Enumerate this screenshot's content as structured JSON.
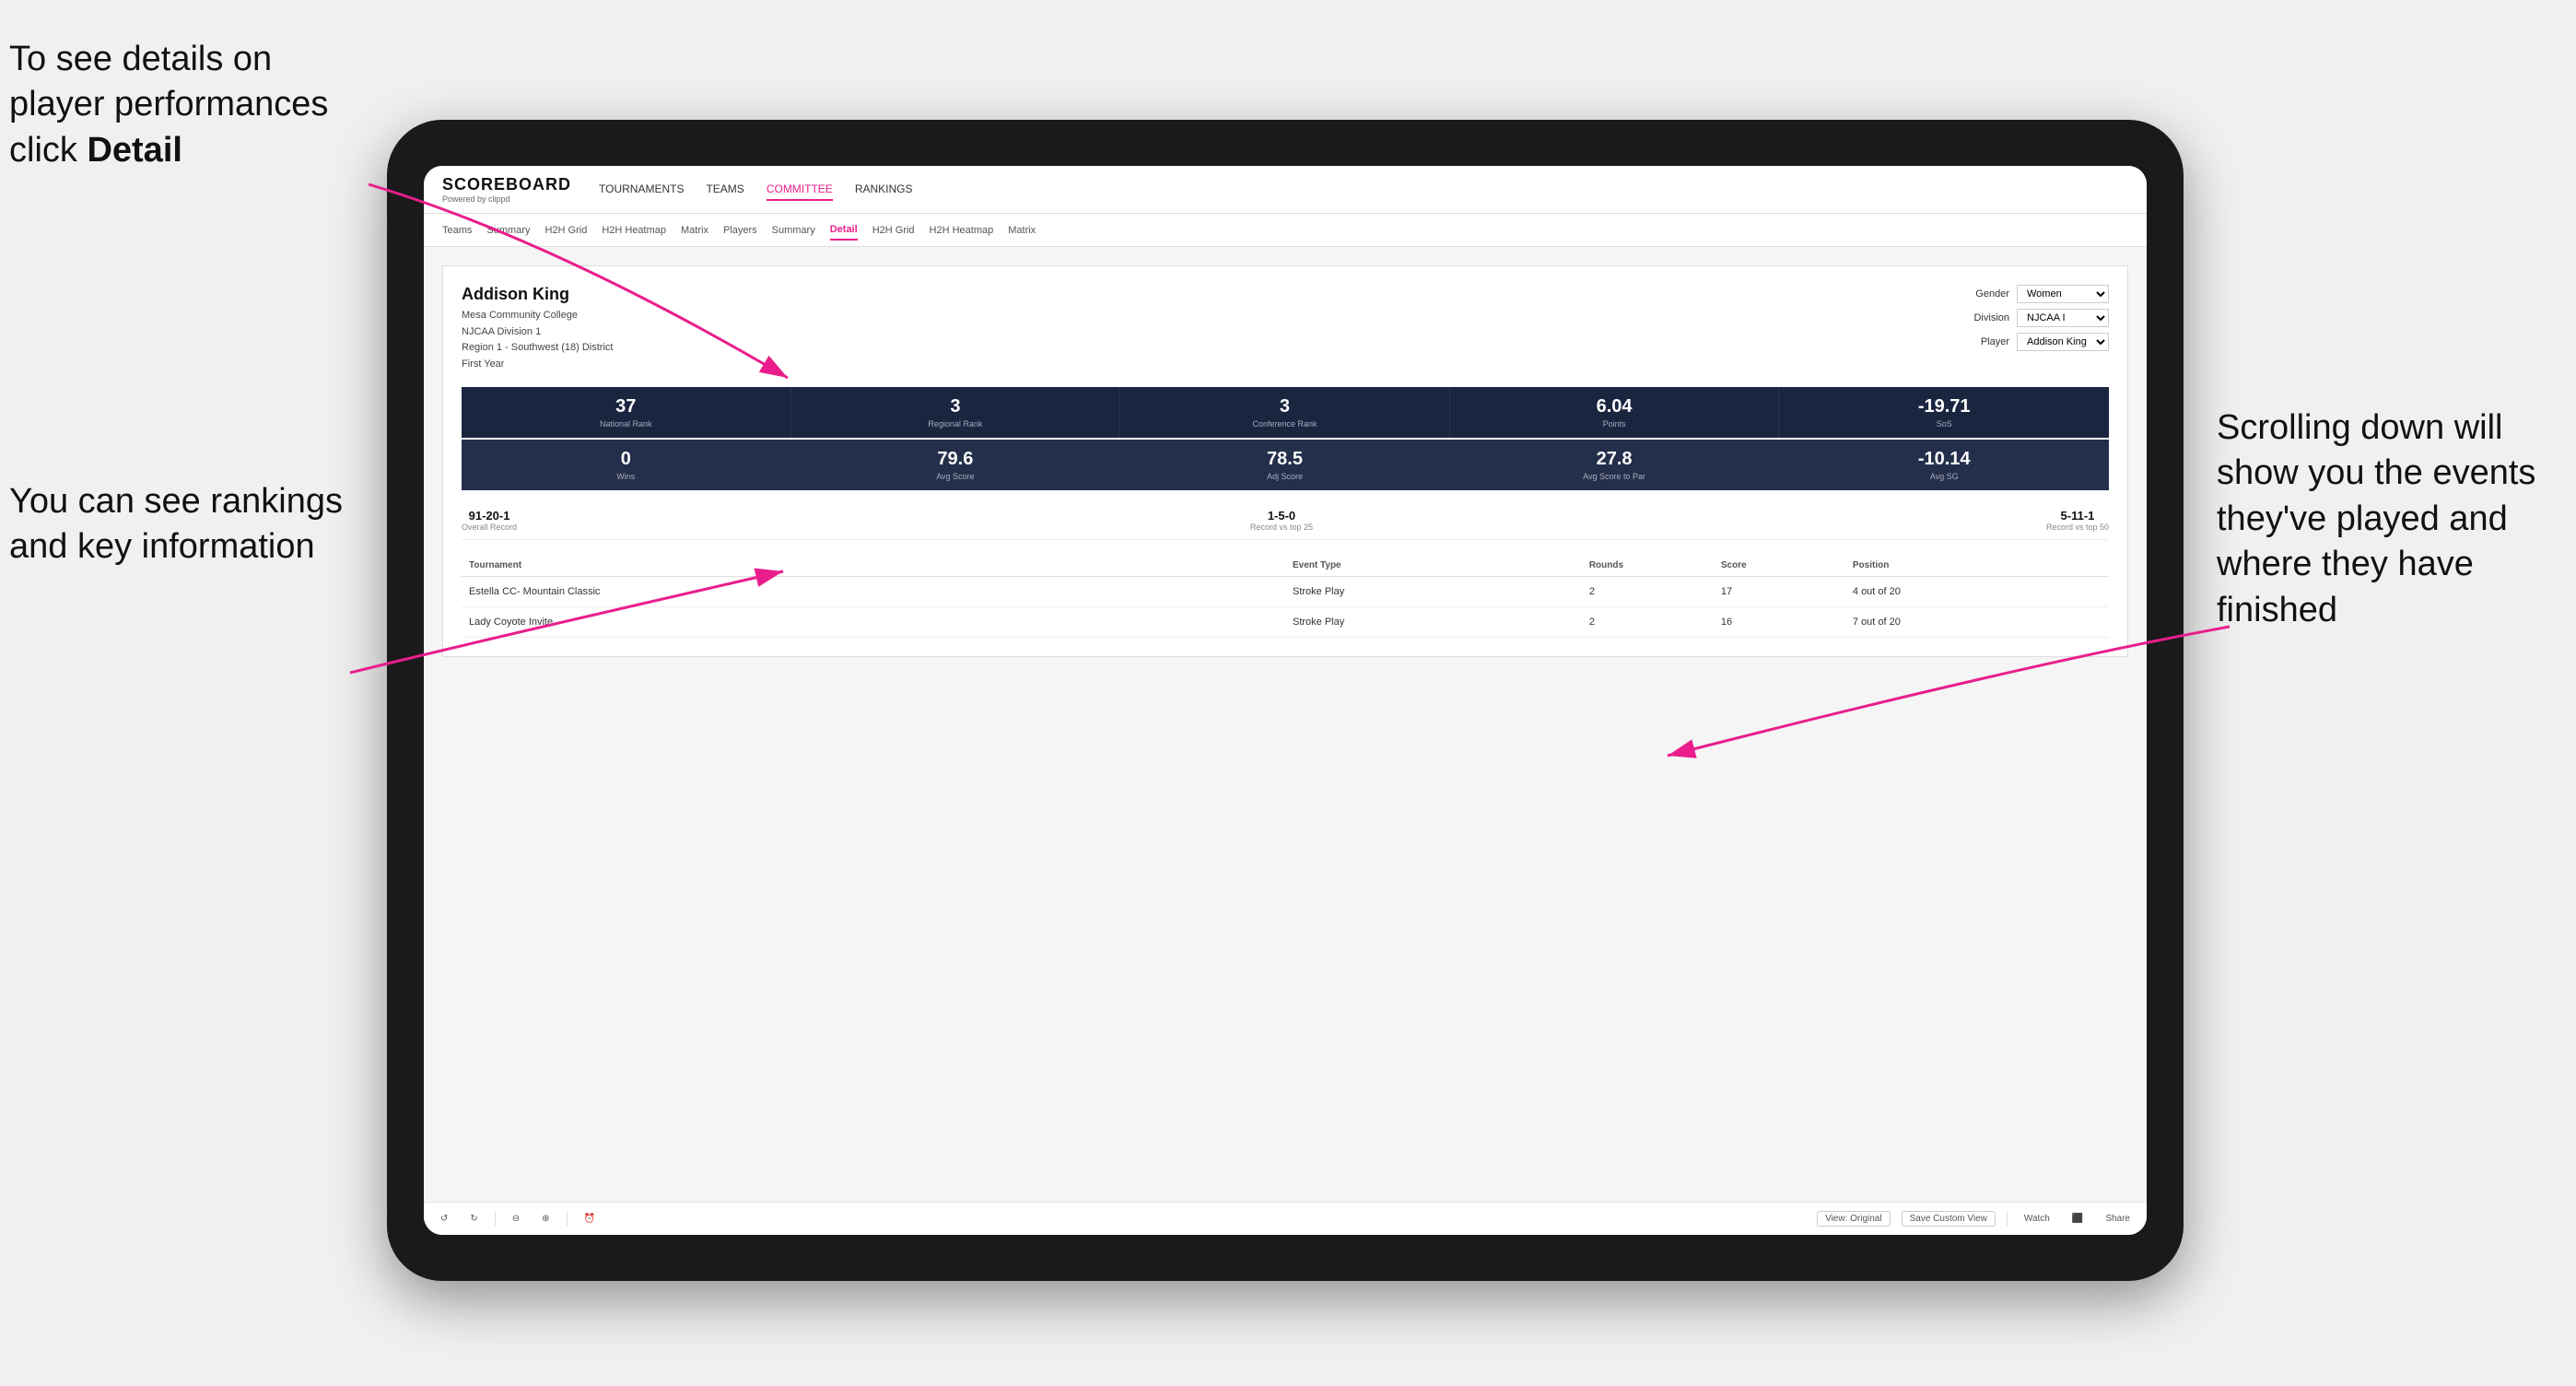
{
  "annotations": {
    "top_left": "To see details on player performances click ",
    "top_left_bold": "Detail",
    "bottom_left_line1": "You can see",
    "bottom_left_line2": "rankings and",
    "bottom_left_line3": "key information",
    "right_line1": "Scrolling down",
    "right_line2": "will show you",
    "right_line3": "the events",
    "right_line4": "they've played",
    "right_line5": "and where they",
    "right_line6": "have finished"
  },
  "app": {
    "logo": "SCOREBOARD",
    "logo_sub": "Powered by clippd",
    "nav": [
      "TOURNAMENTS",
      "TEAMS",
      "COMMITTEE",
      "RANKINGS"
    ],
    "active_nav": "COMMITTEE"
  },
  "sub_nav": [
    "Teams",
    "Summary",
    "H2H Grid",
    "H2H Heatmap",
    "Matrix",
    "Players",
    "Summary",
    "Detail",
    "H2H Grid",
    "H2H Heatmap",
    "Matrix"
  ],
  "active_sub_nav": "Detail",
  "player": {
    "name": "Addison King",
    "school": "Mesa Community College",
    "division": "NJCAA Division 1",
    "region": "Region 1 - Southwest (18) District",
    "year": "First Year"
  },
  "filters": {
    "gender_label": "Gender",
    "gender_value": "Women",
    "division_label": "Division",
    "division_value": "NJCAA I",
    "player_label": "Player",
    "player_value": "Addison King"
  },
  "stats_row1": [
    {
      "value": "37",
      "label": "National Rank"
    },
    {
      "value": "3",
      "label": "Regional Rank"
    },
    {
      "value": "3",
      "label": "Conference Rank"
    },
    {
      "value": "6.04",
      "label": "Points"
    },
    {
      "value": "-19.71",
      "label": "SoS"
    }
  ],
  "stats_row2": [
    {
      "value": "0",
      "label": "Wins"
    },
    {
      "value": "79.6",
      "label": "Avg Score"
    },
    {
      "value": "78.5",
      "label": "Adj Score"
    },
    {
      "value": "27.8",
      "label": "Avg Score to Par"
    },
    {
      "value": "-10.14",
      "label": "Avg SG"
    }
  ],
  "records": [
    {
      "value": "91-20-1",
      "label": "Overall Record"
    },
    {
      "value": "1-5-0",
      "label": "Record vs top 25"
    },
    {
      "value": "5-11-1",
      "label": "Record vs top 50"
    }
  ],
  "table_headers": [
    "Tournament",
    "",
    "Event Type",
    "Rounds",
    "Score",
    "Position"
  ],
  "tournaments": [
    {
      "name": "Estella CC- Mountain Classic",
      "event_type": "Stroke Play",
      "rounds": "2",
      "score": "17",
      "position": "4 out of 20"
    },
    {
      "name": "Lady Coyote Invite",
      "event_type": "Stroke Play",
      "rounds": "2",
      "score": "16",
      "position": "7 out of 20"
    }
  ],
  "toolbar": {
    "undo": "↺",
    "redo": "↻",
    "view_original": "View: Original",
    "save_custom": "Save Custom View",
    "watch": "Watch",
    "share": "Share"
  }
}
